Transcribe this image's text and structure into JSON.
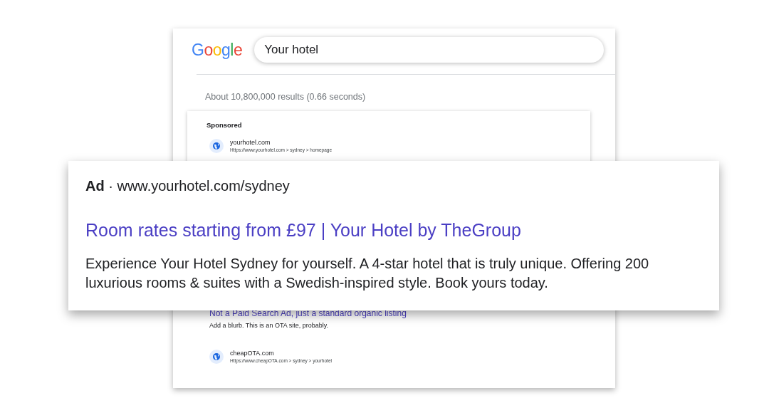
{
  "search_page": {
    "logo": "Google",
    "query": "Your hotel",
    "results_stats": "About 10,800,000 results (0.66 seconds)",
    "sponsored": {
      "label": "Sponsored",
      "site": "yourhotel.com",
      "breadcrumb": "Https://www.yourhotel.com > sydney > homepage"
    },
    "organic": {
      "title": "Not a Paid Search Ad, just a standard organic listing",
      "snippet": "Add a blurb. This is an OTA site, probably."
    },
    "next_result": {
      "site": "cheapOTA.com",
      "breadcrumb": "Https://www.cheapOTA.com > sydney > yourhotel"
    }
  },
  "ad_zoom": {
    "header": "**Ad** · www.yourhotel.com/sydney",
    "title": "Room rates starting from £97 | Your Hotel by TheGroup",
    "description": "Experience Your Hotel Sydney for yourself. A 4-star hotel that is truly unique. Offering 200 luxurious rooms & suites with a Swedish-inspired style. Book yours today."
  }
}
